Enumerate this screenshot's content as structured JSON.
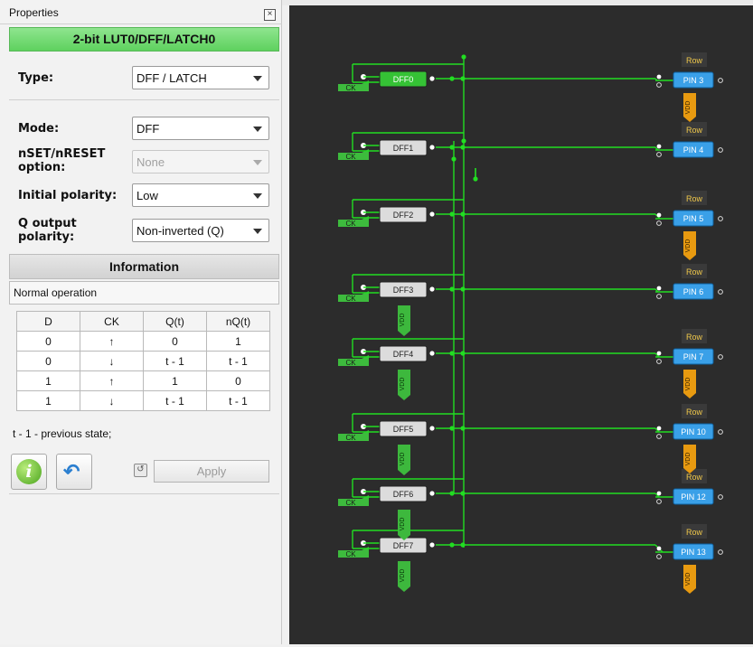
{
  "panel": {
    "title": "Properties",
    "close_glyph": "×",
    "block_title": "2-bit LUT0/DFF/LATCH0"
  },
  "fields": {
    "type": {
      "label": "Type:",
      "value": "DFF / LATCH"
    },
    "mode": {
      "label": "Mode:",
      "value": "DFF"
    },
    "nset": {
      "label_line1": "nSET/nRESET",
      "label_line2": "option:",
      "value": "None"
    },
    "initial_polarity": {
      "label": "Initial polarity:",
      "value": "Low"
    },
    "q_output": {
      "label_line1": "Q output",
      "label_line2": "polarity:",
      "value": "Non-inverted (Q)"
    }
  },
  "information": {
    "header": "Information",
    "text": "Normal operation",
    "table": {
      "headers": [
        "D",
        "CK",
        "Q(t)",
        "nQ(t)"
      ],
      "rows": [
        [
          "0",
          "↑",
          "0",
          "1"
        ],
        [
          "0",
          "↓",
          "t - 1",
          "t - 1"
        ],
        [
          "1",
          "↑",
          "1",
          "0"
        ],
        [
          "1",
          "↓",
          "t - 1",
          "t - 1"
        ]
      ]
    },
    "footnote": "t - 1  - previous state;"
  },
  "buttons": {
    "info_glyph": "i",
    "undo_glyph": "↶",
    "revert_glyph": "↺",
    "apply_label": "Apply"
  },
  "icons": [
    "close-icon",
    "info-icon",
    "undo-icon",
    "revert-icon",
    "chevron-down-icon"
  ],
  "colors": {
    "title_green": "#6fd96f",
    "canvas_bg": "#2c2c2c",
    "wire_green": "#22dd22",
    "dff_active": "#35c235",
    "dff_gray": "#dcdcdc",
    "ck_green": "#3dbb3d",
    "pin_blue": "#3aa0e8",
    "vdd_orange": "#e89a10",
    "vdd_green": "#3db83d",
    "row_bg": "#3a3a3a"
  },
  "schematic": {
    "ck_label": "CK",
    "vdd_label": "VDD",
    "row_label": "Row",
    "flipflops": [
      "DFF0",
      "DFF1",
      "DFF2",
      "DFF3",
      "DFF4",
      "DFF5",
      "DFF6",
      "DFF7"
    ],
    "pins": [
      "PIN 3",
      "PIN 4",
      "PIN 5",
      "PIN 6",
      "PIN 7",
      "PIN 10",
      "PIN 12",
      "PIN 13"
    ]
  }
}
